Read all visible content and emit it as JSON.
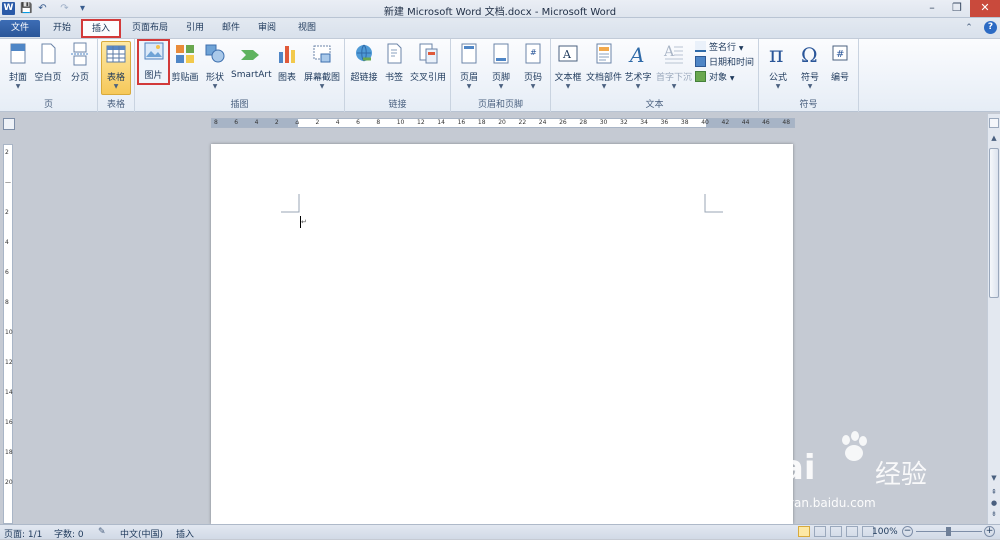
{
  "window": {
    "title": "新建 Microsoft Word 文档.docx - Microsoft Word",
    "app_icon_letter": "W",
    "controls": {
      "minimize": "–",
      "restore": "❐",
      "close": "✕"
    }
  },
  "quick_access": {
    "save": "💾",
    "undo": "↶",
    "redo": "↷",
    "customize": "▾"
  },
  "tabs": [
    {
      "label": "文件"
    },
    {
      "label": "开始"
    },
    {
      "label": "插入"
    },
    {
      "label": "页面布局"
    },
    {
      "label": "引用"
    },
    {
      "label": "邮件"
    },
    {
      "label": "审阅"
    },
    {
      "label": "视图"
    }
  ],
  "ribbon_right": {
    "minimize_ribbon": "⌃",
    "help": "?"
  },
  "ribbon": {
    "groups": {
      "pages": {
        "label": "页",
        "buttons": [
          "封面",
          "空白页",
          "分页"
        ]
      },
      "tables": {
        "label": "表格",
        "buttons": [
          "表格"
        ]
      },
      "illustrations": {
        "label": "插图",
        "buttons": [
          "图片",
          "剪贴画",
          "形状",
          "SmartArt",
          "图表",
          "屏幕截图"
        ]
      },
      "links": {
        "label": "链接",
        "buttons": [
          "超链接",
          "书签",
          "交叉引用"
        ]
      },
      "header_footer": {
        "label": "页眉和页脚",
        "buttons": [
          "页眉",
          "页脚",
          "页码"
        ]
      },
      "text": {
        "label": "文本",
        "buttons": [
          "文本框",
          "文档部件",
          "艺术字",
          "首字下沉"
        ],
        "small": [
          "签名行",
          "日期和时间",
          "对象"
        ]
      },
      "symbols": {
        "label": "符号",
        "buttons": [
          "公式",
          "符号",
          "编号"
        ]
      }
    }
  },
  "ruler": {
    "ticks": [
      "8",
      "6",
      "4",
      "2",
      "",
      "2",
      "4",
      "6",
      "8",
      "10",
      "12",
      "14",
      "16",
      "18",
      "20",
      "22",
      "24",
      "26",
      "28",
      "30",
      "32",
      "34",
      "36",
      "38",
      "40",
      "42",
      "44",
      "46",
      "48"
    ],
    "vticks": [
      "2",
      "",
      "2",
      "4",
      "6",
      "8",
      "10",
      "12",
      "14",
      "16",
      "18",
      "20"
    ]
  },
  "status": {
    "page": "页面: 1/1",
    "words": "字数: 0",
    "language": "中文(中国)",
    "mode": "插入",
    "zoom": "100%"
  },
  "watermark": {
    "brand": "Bai",
    "brand2": "经验",
    "url": "jingyan.baidu.com"
  }
}
